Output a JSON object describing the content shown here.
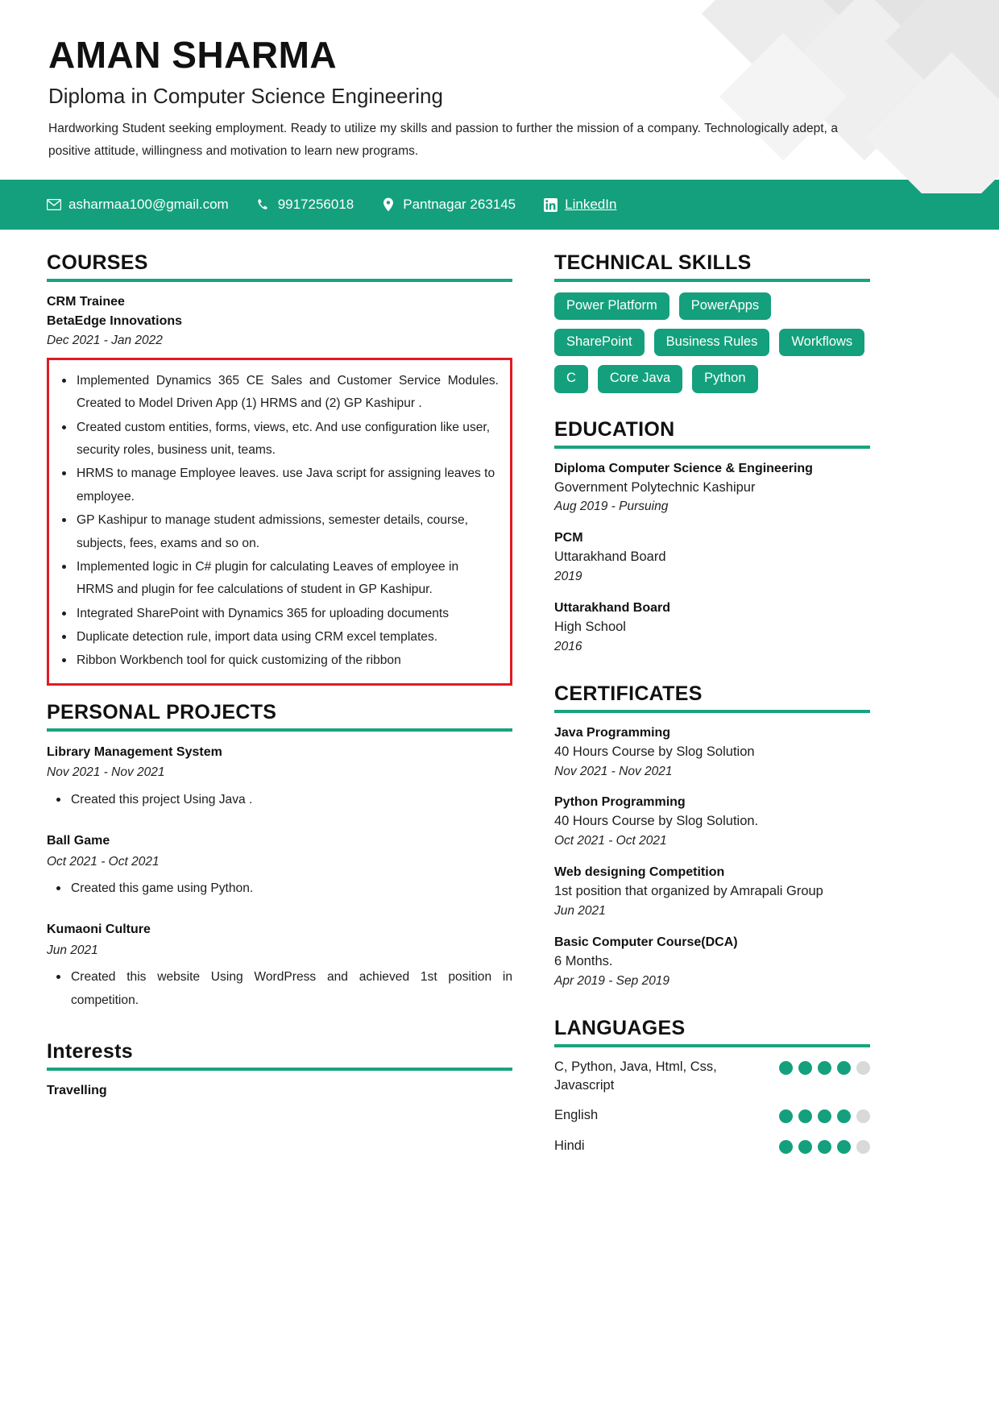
{
  "theme": {
    "accent": "#14a07c",
    "rule": "#1aa37f",
    "highlight_border": "#e01b24",
    "dot_on": "#14a07c",
    "dot_off": "#d9d9d9"
  },
  "header": {
    "name": "AMAN SHARMA",
    "subtitle": "Diploma in Computer Science Engineering",
    "summary": "Hardworking Student seeking employment. Ready to utilize my skills and passion to further the mission of a company. Technologically adept, a positive attitude, willingness and motivation to learn new programs."
  },
  "contact": {
    "email": "asharmaa100@gmail.com",
    "phone": "9917256018",
    "location": "Pantnagar 263145",
    "linkedin": "LinkedIn",
    "icons": {
      "email": "envelope-icon",
      "phone": "phone-icon",
      "location": "map-pin-icon",
      "linkedin": "linkedin-icon"
    }
  },
  "courses": {
    "title": "COURSES",
    "items": [
      {
        "role": "CRM Trainee",
        "company": "BetaEdge Innovations",
        "date": "Dec 2021 - Jan 2022",
        "bullets": [
          "Implemented Dynamics 365 CE Sales and Customer Service Modules. Created to Model Driven App (1) HRMS and (2) GP Kashipur .",
          "Created custom entities, forms, views, etc. And use configuration like user, security roles, business unit, teams.",
          "HRMS to manage Employee leaves. use Java script for assigning leaves to employee.",
          "GP Kashipur to manage student admissions, semester details, course, subjects, fees, exams and so on.",
          "Implemented logic in C# plugin for calculating Leaves of employee in HRMS and plugin for fee calculations of student in GP Kashipur.",
          "Integrated SharePoint with Dynamics 365 for uploading documents",
          "Duplicate detection rule, import data using CRM excel templates.",
          "Ribbon Workbench tool for quick customizing of the ribbon"
        ]
      }
    ]
  },
  "personal_projects": {
    "title": "PERSONAL PROJECTS",
    "items": [
      {
        "name": "Library Management System",
        "date": "Nov 2021 - Nov 2021",
        "bullets": [
          "Created this project Using Java ."
        ]
      },
      {
        "name": "Ball Game",
        "date": "Oct 2021 - Oct 2021",
        "bullets": [
          "Created this game using Python."
        ]
      },
      {
        "name": "Kumaoni Culture",
        "date": "Jun 2021",
        "bullets": [
          "Created this website Using WordPress and achieved 1st position in competition."
        ]
      }
    ]
  },
  "interests": {
    "title": "Interests",
    "items": [
      "Travelling"
    ]
  },
  "technical_skills": {
    "title": "TECHNICAL SKILLS",
    "tags": [
      "Power Platform",
      "PowerApps",
      "SharePoint",
      "Business Rules",
      "Workflows",
      "C",
      "Core Java",
      "Python"
    ]
  },
  "education": {
    "title": "EDUCATION",
    "items": [
      {
        "degree": "Diploma Computer Science & Engineering",
        "institution": "Government Polytechnic Kashipur",
        "date": "Aug 2019 - Pursuing"
      },
      {
        "degree": "PCM",
        "institution": "Uttarakhand Board",
        "date": "2019"
      },
      {
        "degree": "Uttarakhand Board",
        "institution": "High School",
        "date": "2016"
      }
    ]
  },
  "certificates": {
    "title": "CERTIFICATES",
    "items": [
      {
        "name": "Java Programming",
        "detail": "40 Hours Course by Slog Solution",
        "date": "Nov 2021 - Nov 2021"
      },
      {
        "name": "Python Programming",
        "detail": "40 Hours Course by Slog Solution.",
        "date": "Oct 2021 - Oct 2021"
      },
      {
        "name": "Web designing Competition",
        "detail": "1st position that organized by Amrapali Group",
        "date": "Jun 2021"
      },
      {
        "name": "Basic Computer Course(DCA)",
        "detail": "6 Months.",
        "date": "Apr 2019 - Sep 2019"
      }
    ]
  },
  "languages": {
    "title": "LANGUAGES",
    "items": [
      {
        "name": "C, Python, Java, Html, Css, Javascript",
        "level": 4,
        "max": 5
      },
      {
        "name": "English",
        "level": 4,
        "max": 5
      },
      {
        "name": "Hindi",
        "level": 4,
        "max": 5
      }
    ]
  }
}
